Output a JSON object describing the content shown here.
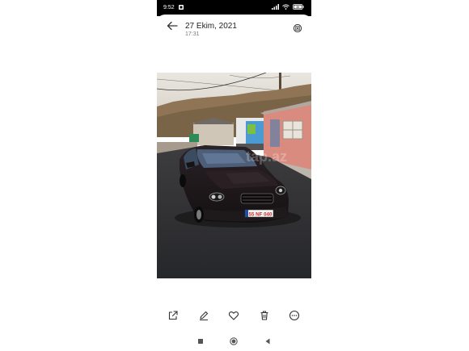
{
  "status_bar": {
    "time": "9:52",
    "battery": "39"
  },
  "header": {
    "title": "27 Ekim, 2021",
    "subtitle": "17:31"
  },
  "photo": {
    "plate_text": "55 NF 040",
    "watermark": "tap.az"
  },
  "toolbar": {
    "items": [
      "share-icon",
      "edit-icon",
      "favorite-icon",
      "delete-icon",
      "more-icon"
    ]
  },
  "navbar": {
    "items": [
      "recents-icon",
      "home-icon",
      "back-icon"
    ]
  },
  "colors": {
    "status_bg": "#000000",
    "page_bg": "#ffffff",
    "icon": "#333333",
    "text_primary": "#222222",
    "text_secondary": "#777777"
  }
}
